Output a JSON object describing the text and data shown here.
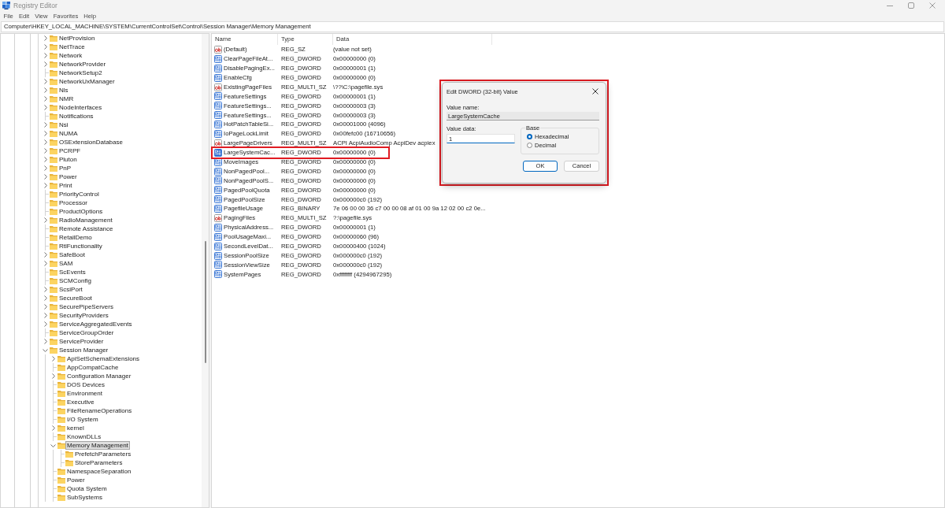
{
  "window": {
    "title": "Registry Editor"
  },
  "menu": [
    "File",
    "Edit",
    "View",
    "Favorites",
    "Help"
  ],
  "address": "Computer\\HKEY_LOCAL_MACHINE\\SYSTEM\\CurrentControlSet\\Control\\Session Manager\\Memory Management",
  "tree": {
    "items": [
      {
        "label": "NetProvision",
        "has_children": true,
        "expanded": false,
        "selected": false
      },
      {
        "label": "NetTrace",
        "has_children": true,
        "expanded": false,
        "selected": false
      },
      {
        "label": "Network",
        "has_children": true,
        "expanded": false,
        "selected": false
      },
      {
        "label": "NetworkProvider",
        "has_children": true,
        "expanded": false,
        "selected": false
      },
      {
        "label": "NetworkSetup2",
        "has_children": false,
        "expanded": false,
        "selected": false
      },
      {
        "label": "NetworkUxManager",
        "has_children": true,
        "expanded": false,
        "selected": false
      },
      {
        "label": "Nls",
        "has_children": true,
        "expanded": false,
        "selected": false
      },
      {
        "label": "NMR",
        "has_children": true,
        "expanded": false,
        "selected": false
      },
      {
        "label": "NodeInterfaces",
        "has_children": true,
        "expanded": false,
        "selected": false
      },
      {
        "label": "Notifications",
        "has_children": false,
        "expanded": false,
        "selected": false
      },
      {
        "label": "Nsi",
        "has_children": true,
        "expanded": false,
        "selected": false
      },
      {
        "label": "NUMA",
        "has_children": true,
        "expanded": false,
        "selected": false
      },
      {
        "label": "OSExtensionDatabase",
        "has_children": true,
        "expanded": false,
        "selected": false
      },
      {
        "label": "PCRPF",
        "has_children": true,
        "expanded": false,
        "selected": false
      },
      {
        "label": "Pluton",
        "has_children": true,
        "expanded": false,
        "selected": false
      },
      {
        "label": "PnP",
        "has_children": true,
        "expanded": false,
        "selected": false
      },
      {
        "label": "Power",
        "has_children": true,
        "expanded": false,
        "selected": false
      },
      {
        "label": "Print",
        "has_children": true,
        "expanded": false,
        "selected": false
      },
      {
        "label": "PriorityControl",
        "has_children": false,
        "expanded": false,
        "selected": false
      },
      {
        "label": "Processor",
        "has_children": false,
        "expanded": false,
        "selected": false
      },
      {
        "label": "ProductOptions",
        "has_children": false,
        "expanded": false,
        "selected": false
      },
      {
        "label": "RadioManagement",
        "has_children": true,
        "expanded": false,
        "selected": false
      },
      {
        "label": "Remote Assistance",
        "has_children": false,
        "expanded": false,
        "selected": false
      },
      {
        "label": "RetailDemo",
        "has_children": false,
        "expanded": false,
        "selected": false
      },
      {
        "label": "RtlFunctionality",
        "has_children": false,
        "expanded": false,
        "selected": false
      },
      {
        "label": "SafeBoot",
        "has_children": true,
        "expanded": false,
        "selected": false
      },
      {
        "label": "SAM",
        "has_children": true,
        "expanded": false,
        "selected": false
      },
      {
        "label": "ScEvents",
        "has_children": false,
        "expanded": false,
        "selected": false
      },
      {
        "label": "SCMConfig",
        "has_children": false,
        "expanded": false,
        "selected": false
      },
      {
        "label": "ScsiPort",
        "has_children": true,
        "expanded": false,
        "selected": false
      },
      {
        "label": "SecureBoot",
        "has_children": true,
        "expanded": false,
        "selected": false
      },
      {
        "label": "SecurePipeServers",
        "has_children": true,
        "expanded": false,
        "selected": false
      },
      {
        "label": "SecurityProviders",
        "has_children": true,
        "expanded": false,
        "selected": false
      },
      {
        "label": "ServiceAggregatedEvents",
        "has_children": true,
        "expanded": false,
        "selected": false
      },
      {
        "label": "ServiceGroupOrder",
        "has_children": false,
        "expanded": false,
        "selected": false
      },
      {
        "label": "ServiceProvider",
        "has_children": true,
        "expanded": false,
        "selected": false
      },
      {
        "label": "Session Manager",
        "has_children": true,
        "expanded": true,
        "selected": false,
        "children": [
          {
            "label": "ApiSetSchemaExtensions",
            "has_children": true,
            "expanded": false,
            "selected": false
          },
          {
            "label": "AppCompatCache",
            "has_children": false,
            "expanded": false,
            "selected": false
          },
          {
            "label": "Configuration Manager",
            "has_children": true,
            "expanded": false,
            "selected": false
          },
          {
            "label": "DOS Devices",
            "has_children": false,
            "expanded": false,
            "selected": false
          },
          {
            "label": "Environment",
            "has_children": false,
            "expanded": false,
            "selected": false
          },
          {
            "label": "Executive",
            "has_children": false,
            "expanded": false,
            "selected": false
          },
          {
            "label": "FileRenameOperations",
            "has_children": false,
            "expanded": false,
            "selected": false
          },
          {
            "label": "I/O System",
            "has_children": false,
            "expanded": false,
            "selected": false
          },
          {
            "label": "kernel",
            "has_children": true,
            "expanded": false,
            "selected": false
          },
          {
            "label": "KnownDLLs",
            "has_children": false,
            "expanded": false,
            "selected": false
          },
          {
            "label": "Memory Management",
            "has_children": true,
            "expanded": true,
            "selected": true,
            "children": [
              {
                "label": "PrefetchParameters",
                "has_children": false,
                "expanded": false,
                "selected": false
              },
              {
                "label": "StoreParameters",
                "has_children": false,
                "expanded": false,
                "selected": false
              }
            ]
          },
          {
            "label": "NamespaceSeparation",
            "has_children": false,
            "expanded": false,
            "selected": false
          },
          {
            "label": "Power",
            "has_children": false,
            "expanded": false,
            "selected": false
          },
          {
            "label": "Quota System",
            "has_children": false,
            "expanded": false,
            "selected": false
          },
          {
            "label": "SubSystems",
            "has_children": false,
            "expanded": false,
            "selected": false
          }
        ]
      }
    ]
  },
  "values": {
    "columns": [
      "Name",
      "Type",
      "Data"
    ],
    "rows": [
      {
        "kind": "string",
        "name": "(Default)",
        "type": "REG_SZ",
        "data": "(value not set)",
        "selected": false,
        "highlighted": false
      },
      {
        "kind": "binary",
        "name": "ClearPageFileAt...",
        "type": "REG_DWORD",
        "data": "0x00000000 (0)",
        "selected": false,
        "highlighted": false
      },
      {
        "kind": "binary",
        "name": "DisablePagingEx...",
        "type": "REG_DWORD",
        "data": "0x00000001 (1)",
        "selected": false,
        "highlighted": false
      },
      {
        "kind": "binary",
        "name": "EnableCfg",
        "type": "REG_DWORD",
        "data": "0x00000000 (0)",
        "selected": false,
        "highlighted": false
      },
      {
        "kind": "string",
        "name": "ExistingPageFiles",
        "type": "REG_MULTI_SZ",
        "data": "\\??\\C:\\pagefile.sys",
        "selected": false,
        "highlighted": false
      },
      {
        "kind": "binary",
        "name": "FeatureSettings",
        "type": "REG_DWORD",
        "data": "0x00000001 (1)",
        "selected": false,
        "highlighted": false
      },
      {
        "kind": "binary",
        "name": "FeatureSettings...",
        "type": "REG_DWORD",
        "data": "0x00000003 (3)",
        "selected": false,
        "highlighted": false
      },
      {
        "kind": "binary",
        "name": "FeatureSettings...",
        "type": "REG_DWORD",
        "data": "0x00000003 (3)",
        "selected": false,
        "highlighted": false
      },
      {
        "kind": "binary",
        "name": "HotPatchTableSi...",
        "type": "REG_DWORD",
        "data": "0x00001000 (4096)",
        "selected": false,
        "highlighted": false
      },
      {
        "kind": "binary",
        "name": "IoPageLockLimit",
        "type": "REG_DWORD",
        "data": "0x00fefc00 (16710656)",
        "selected": false,
        "highlighted": false
      },
      {
        "kind": "string",
        "name": "LargePageDrivers",
        "type": "REG_MULTI_SZ",
        "data": "ACPI AcpiAudioComp AcpiDev acpiex",
        "selected": false,
        "highlighted": false
      },
      {
        "kind": "binary",
        "name": "LargeSystemCac...",
        "type": "REG_DWORD",
        "data": "0x00000000 (0)",
        "selected": true,
        "highlighted": true
      },
      {
        "kind": "binary",
        "name": "MoveImages",
        "type": "REG_DWORD",
        "data": "0x00000000 (0)",
        "selected": false,
        "highlighted": false
      },
      {
        "kind": "binary",
        "name": "NonPagedPool...",
        "type": "REG_DWORD",
        "data": "0x00000000 (0)",
        "selected": false,
        "highlighted": false
      },
      {
        "kind": "binary",
        "name": "NonPagedPoolS...",
        "type": "REG_DWORD",
        "data": "0x00000000 (0)",
        "selected": false,
        "highlighted": false
      },
      {
        "kind": "binary",
        "name": "PagedPoolQuota",
        "type": "REG_DWORD",
        "data": "0x00000000 (0)",
        "selected": false,
        "highlighted": false
      },
      {
        "kind": "binary",
        "name": "PagedPoolSize",
        "type": "REG_DWORD",
        "data": "0x000000c0 (192)",
        "selected": false,
        "highlighted": false
      },
      {
        "kind": "binary",
        "name": "PagefileUsage",
        "type": "REG_BINARY",
        "data": "7e 06 00 00 36 c7 00 00 08 af 01 00 9a 12 02 00 c2 0e...",
        "selected": false,
        "highlighted": false
      },
      {
        "kind": "string",
        "name": "PagingFiles",
        "type": "REG_MULTI_SZ",
        "data": "?:\\pagefile.sys",
        "selected": false,
        "highlighted": false
      },
      {
        "kind": "binary",
        "name": "PhysicalAddress...",
        "type": "REG_DWORD",
        "data": "0x00000001 (1)",
        "selected": false,
        "highlighted": false
      },
      {
        "kind": "binary",
        "name": "PoolUsageMaxi...",
        "type": "REG_DWORD",
        "data": "0x00000060 (96)",
        "selected": false,
        "highlighted": false
      },
      {
        "kind": "binary",
        "name": "SecondLevelDat...",
        "type": "REG_DWORD",
        "data": "0x00000400 (1024)",
        "selected": false,
        "highlighted": false
      },
      {
        "kind": "binary",
        "name": "SessionPoolSize",
        "type": "REG_DWORD",
        "data": "0x000000c0 (192)",
        "selected": false,
        "highlighted": false
      },
      {
        "kind": "binary",
        "name": "SessionViewSize",
        "type": "REG_DWORD",
        "data": "0x000000c0 (192)",
        "selected": false,
        "highlighted": false
      },
      {
        "kind": "binary",
        "name": "SystemPages",
        "type": "REG_DWORD",
        "data": "0xffffffff (4294967295)",
        "selected": false,
        "highlighted": false
      }
    ]
  },
  "dialog": {
    "title": "Edit DWORD (32-bit) Value",
    "highlighted": true,
    "value_name": {
      "label": "Value name:",
      "value": "LargeSystemCache"
    },
    "value_data": {
      "label": "Value data:",
      "value": "1",
      "focused": true
    },
    "base": {
      "label": "Base",
      "options": [
        {
          "label": "Hexadecimal",
          "selected": true
        },
        {
          "label": "Decimal",
          "selected": false
        }
      ]
    },
    "buttons": [
      {
        "label": "OK",
        "default": true
      },
      {
        "label": "Cancel",
        "default": false
      }
    ]
  }
}
